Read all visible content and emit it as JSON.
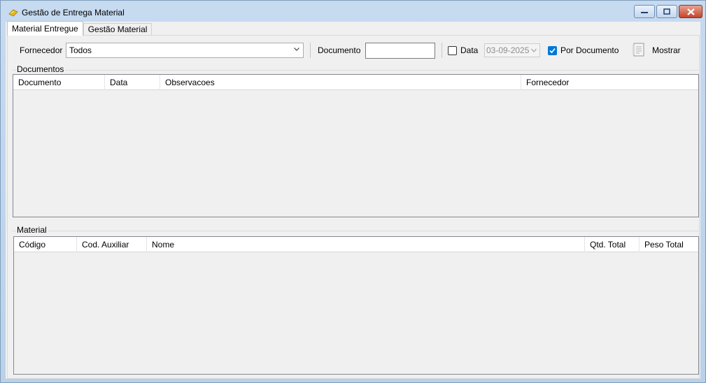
{
  "window": {
    "title": "Gestão de Entrega Material",
    "buttons": [
      "minimize",
      "maximize",
      "close"
    ]
  },
  "tabs": [
    {
      "label": "Material Entregue",
      "active": true
    },
    {
      "label": "Gestão Material",
      "active": false
    }
  ],
  "filters": {
    "fornecedor_label": "Fornecedor",
    "fornecedor_value": "Todos",
    "documento_label": "Documento",
    "documento_value": "",
    "data_label": "Data",
    "data_checked": false,
    "data_value": "03-09-2025",
    "por_documento_label": "Por Documento",
    "por_documento_checked": true,
    "mostrar_label": "Mostrar"
  },
  "documentos": {
    "title": "Documentos",
    "columns": [
      "Documento",
      "Data",
      "Observacoes",
      "Fornecedor"
    ],
    "rows": []
  },
  "material": {
    "title": "Material",
    "columns": [
      "Código",
      "Cod. Auxiliar",
      "Nome",
      "Qtd. Total",
      "Peso Total"
    ],
    "rows": []
  },
  "colors": {
    "accent": "#0078d7",
    "close_button": "#c4432b"
  }
}
